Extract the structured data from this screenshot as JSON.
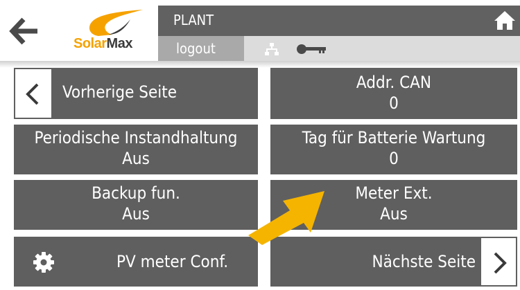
{
  "header": {
    "plant": "PLANT",
    "logout": "logout",
    "logo": {
      "solar": "Solar",
      "max": "Max"
    }
  },
  "tiles": {
    "prev_page": "Vorherige Seite",
    "addr_can": {
      "label": "Addr. CAN",
      "value": "0"
    },
    "periodic_maintenance": {
      "label": "Periodische Instandhaltung",
      "value": "Aus"
    },
    "battery_maintenance_day": {
      "label": "Tag für Batterie Wartung",
      "value": "0"
    },
    "backup_fun": {
      "label": "Backup fun.",
      "value": "Aus"
    },
    "meter_ext": {
      "label": "Meter Ext.",
      "value": "Aus"
    },
    "pv_meter_conf": "PV meter Conf.",
    "next_page": "Nächste Seite"
  },
  "icons": {
    "back": "back-arrow-icon",
    "home": "home-icon",
    "network": "network-icon",
    "key": "key-icon",
    "gear": "gear-icon",
    "chevron_left": "chevron-left-icon",
    "chevron_right": "chevron-right-icon"
  },
  "colors": {
    "tile": "#5f5f5f",
    "header_bar": "#616161",
    "logout_bar": "#a9a9a9",
    "status_bar": "#dcdcdc",
    "accent_arrow": "#f5b400",
    "logo_orange": "#f5a200"
  }
}
